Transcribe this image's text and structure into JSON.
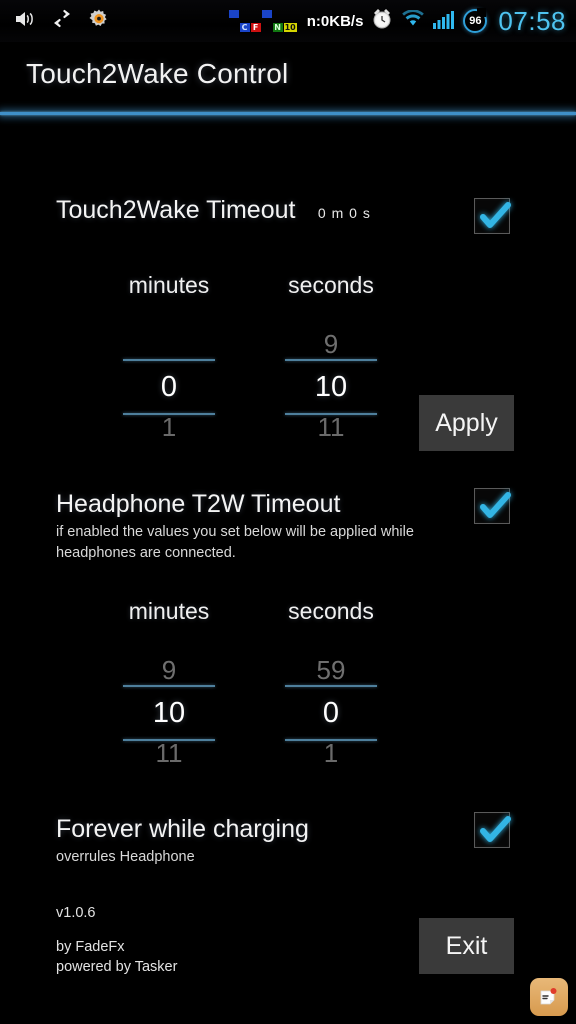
{
  "statusbar": {
    "icons": [
      "volume-icon",
      "sync-arrows-icon",
      "gear-icon",
      "alarm-clock-icon",
      "wifi-icon",
      "signal-bars-icon"
    ],
    "badges": [
      {
        "name": "badge-c",
        "label": "C",
        "color": "#1a44c8"
      },
      {
        "name": "badge-f",
        "label": "F",
        "color": "#cc1111"
      },
      {
        "name": "badge-n",
        "label": "N",
        "color": "#117711"
      },
      {
        "name": "badge-10",
        "label": "10",
        "color": "#d6d600"
      }
    ],
    "network_speed": "n:0KB/s",
    "battery_percent": "96",
    "clock": "07:58",
    "clock_color": "#4ec3f0"
  },
  "header": {
    "title": "Touch2Wake Control",
    "rule_color": "#3f90c8"
  },
  "sections": {
    "touch2wake": {
      "title": "Touch2Wake Timeout",
      "inline_value": "0 m  0 s",
      "checkbox_checked": true,
      "checkbox_color": "#33b5e5",
      "picker": {
        "minutes": {
          "label": "minutes",
          "above": "",
          "value": "0",
          "below": "1"
        },
        "seconds": {
          "label": "seconds",
          "above": "9",
          "value": "10",
          "below": "11"
        }
      },
      "apply_label": "Apply"
    },
    "headphone": {
      "title": "Headphone T2W Timeout",
      "subtitle": "if enabled the values you set below will be applied while headphones are connected.",
      "checkbox_checked": true,
      "picker": {
        "minutes": {
          "label": "minutes",
          "above": "9",
          "value": "10",
          "below": "11"
        },
        "seconds": {
          "label": "seconds",
          "above": "59",
          "value": "0",
          "below": "1"
        }
      }
    },
    "charging": {
      "title": "Forever while charging",
      "subtitle": "overrules Headphone",
      "checkbox_checked": true
    }
  },
  "footer": {
    "version": "v1.0.6",
    "author": "by FadeFx",
    "powered": "powered by Tasker",
    "exit_label": "Exit"
  }
}
